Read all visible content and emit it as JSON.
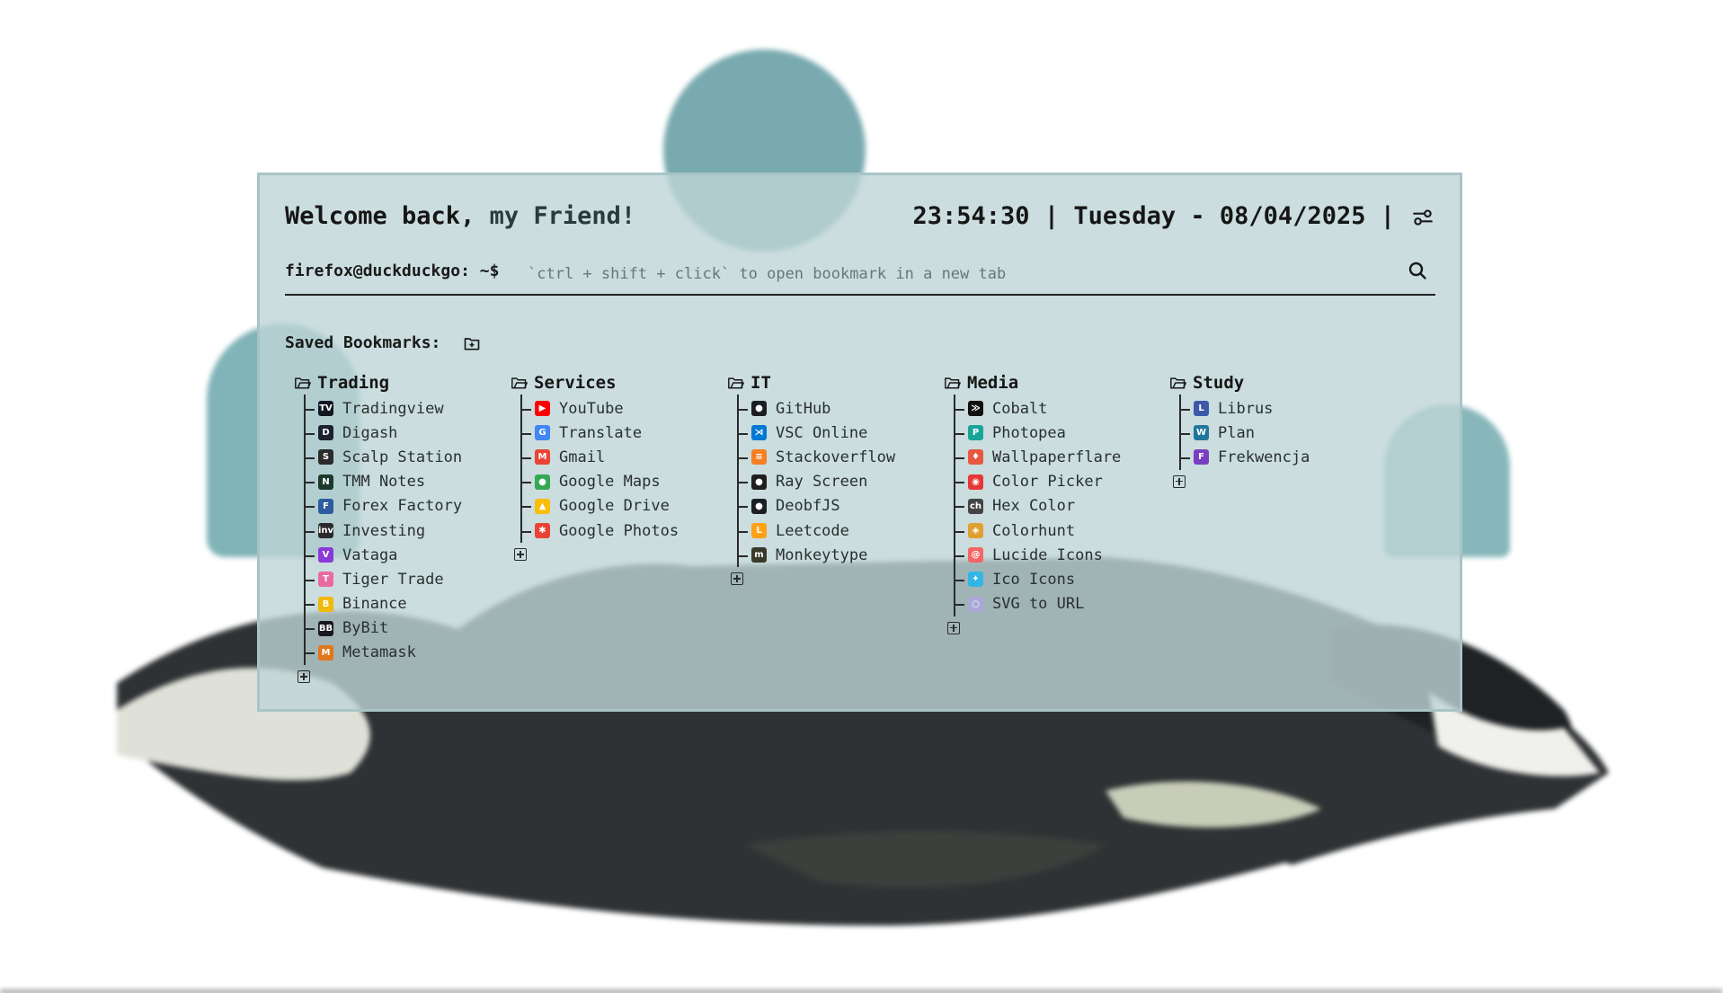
{
  "header": {
    "welcome_prefix": "Welcome back,",
    "welcome_name": "my Friend!",
    "time": "23:54:30",
    "separator": "|",
    "date": "Tuesday - 08/04/2025"
  },
  "search": {
    "prompt": "firefox@duckduckgo: ~$",
    "placeholder": "`ctrl + shift + click` to open bookmark in a new tab"
  },
  "bookmarks": {
    "label": "Saved Bookmarks:",
    "groups": [
      {
        "name": "Trading",
        "items": [
          {
            "label": "Tradingview",
            "icon": "tradingview-icon",
            "color": "#131722",
            "glyph": "TV"
          },
          {
            "label": "Digash",
            "icon": "digash-icon",
            "color": "#1d2230",
            "glyph": "D"
          },
          {
            "label": "Scalp Station",
            "icon": "scalp-station-icon",
            "color": "#2b2b2b",
            "glyph": "S"
          },
          {
            "label": "TMM Notes",
            "icon": "tmm-notes-icon",
            "color": "#1c3a2c",
            "glyph": "N"
          },
          {
            "label": "Forex Factory",
            "icon": "forex-factory-icon",
            "color": "#2f5c9e",
            "glyph": "F"
          },
          {
            "label": "Investing",
            "icon": "investing-icon",
            "color": "#2a2a2a",
            "glyph": "inv"
          },
          {
            "label": "Vataga",
            "icon": "vataga-icon",
            "color": "#8a3ad6",
            "glyph": "V"
          },
          {
            "label": "Tiger Trade",
            "icon": "tiger-trade-icon",
            "color": "#e86aa0",
            "glyph": "T"
          },
          {
            "label": "Binance",
            "icon": "binance-icon",
            "color": "#f0b90b",
            "glyph": "B"
          },
          {
            "label": "ByBit",
            "icon": "bybit-icon",
            "color": "#17181e",
            "glyph": "BB"
          },
          {
            "label": "Metamask",
            "icon": "metamask-icon",
            "color": "#e2761b",
            "glyph": "M"
          }
        ]
      },
      {
        "name": "Services",
        "items": [
          {
            "label": "YouTube",
            "icon": "youtube-icon",
            "color": "#ff0000",
            "glyph": "▶"
          },
          {
            "label": "Translate",
            "icon": "translate-icon",
            "color": "#4285f4",
            "glyph": "G"
          },
          {
            "label": "Gmail",
            "icon": "gmail-icon",
            "color": "#ea4335",
            "glyph": "M"
          },
          {
            "label": "Google Maps",
            "icon": "google-maps-icon",
            "color": "#34a853",
            "glyph": "●"
          },
          {
            "label": "Google Drive",
            "icon": "google-drive-icon",
            "color": "#fbbc04",
            "glyph": "▲"
          },
          {
            "label": "Google Photos",
            "icon": "google-photos-icon",
            "color": "#ea4335",
            "glyph": "✱"
          }
        ]
      },
      {
        "name": "IT",
        "items": [
          {
            "label": "GitHub",
            "icon": "github-icon",
            "color": "#1b1f23",
            "glyph": "●"
          },
          {
            "label": "VSC Online",
            "icon": "vscode-icon",
            "color": "#0078d4",
            "glyph": "⋊"
          },
          {
            "label": "Stackoverflow",
            "icon": "stackoverflow-icon",
            "color": "#f48024",
            "glyph": "≡"
          },
          {
            "label": "Ray Screen",
            "icon": "ray-screen-icon",
            "color": "#1f1f1f",
            "glyph": "●"
          },
          {
            "label": "DeobfJS",
            "icon": "deobfjs-icon",
            "color": "#1b1f23",
            "glyph": "●"
          },
          {
            "label": "Leetcode",
            "icon": "leetcode-icon",
            "color": "#ffa116",
            "glyph": "L"
          },
          {
            "label": "Monkeytype",
            "icon": "monkeytype-icon",
            "color": "#3a3a2a",
            "glyph": "m"
          }
        ]
      },
      {
        "name": "Media",
        "items": [
          {
            "label": "Cobalt",
            "icon": "cobalt-icon",
            "color": "#111111",
            "glyph": "≫"
          },
          {
            "label": "Photopea",
            "icon": "photopea-icon",
            "color": "#18a497",
            "glyph": "P"
          },
          {
            "label": "Wallpaperflare",
            "icon": "wallpaperflare-icon",
            "color": "#e8573f",
            "glyph": "♦"
          },
          {
            "label": "Color Picker",
            "icon": "color-picker-icon",
            "color": "#e53935",
            "glyph": "◉"
          },
          {
            "label": "Hex Color",
            "icon": "hex-color-icon",
            "color": "#444444",
            "glyph": "ch"
          },
          {
            "label": "Colorhunt",
            "icon": "colorhunt-icon",
            "color": "#e0a030",
            "glyph": "◈"
          },
          {
            "label": "Lucide Icons",
            "icon": "lucide-icon",
            "color": "#f56565",
            "glyph": "@"
          },
          {
            "label": "Ico Icons",
            "icon": "ico-icons-icon",
            "color": "#33b5e5",
            "glyph": "✦"
          },
          {
            "label": "SVG to URL",
            "icon": "svg-to-url-icon",
            "color": "#a8a8d8",
            "glyph": "○"
          }
        ]
      },
      {
        "name": "Study",
        "items": [
          {
            "label": "Librus",
            "icon": "librus-icon",
            "color": "#3a5aa8",
            "glyph": "L"
          },
          {
            "label": "Plan",
            "icon": "wordpress-icon",
            "color": "#21759b",
            "glyph": "W"
          },
          {
            "label": "Frekwencja",
            "icon": "frekwencja-icon",
            "color": "#7a3fc0",
            "glyph": "F"
          }
        ]
      }
    ]
  },
  "colors": {
    "panel_bg": "#bed4d6",
    "panel_border": "#a9c4c6",
    "text": "#1b1b1b"
  }
}
